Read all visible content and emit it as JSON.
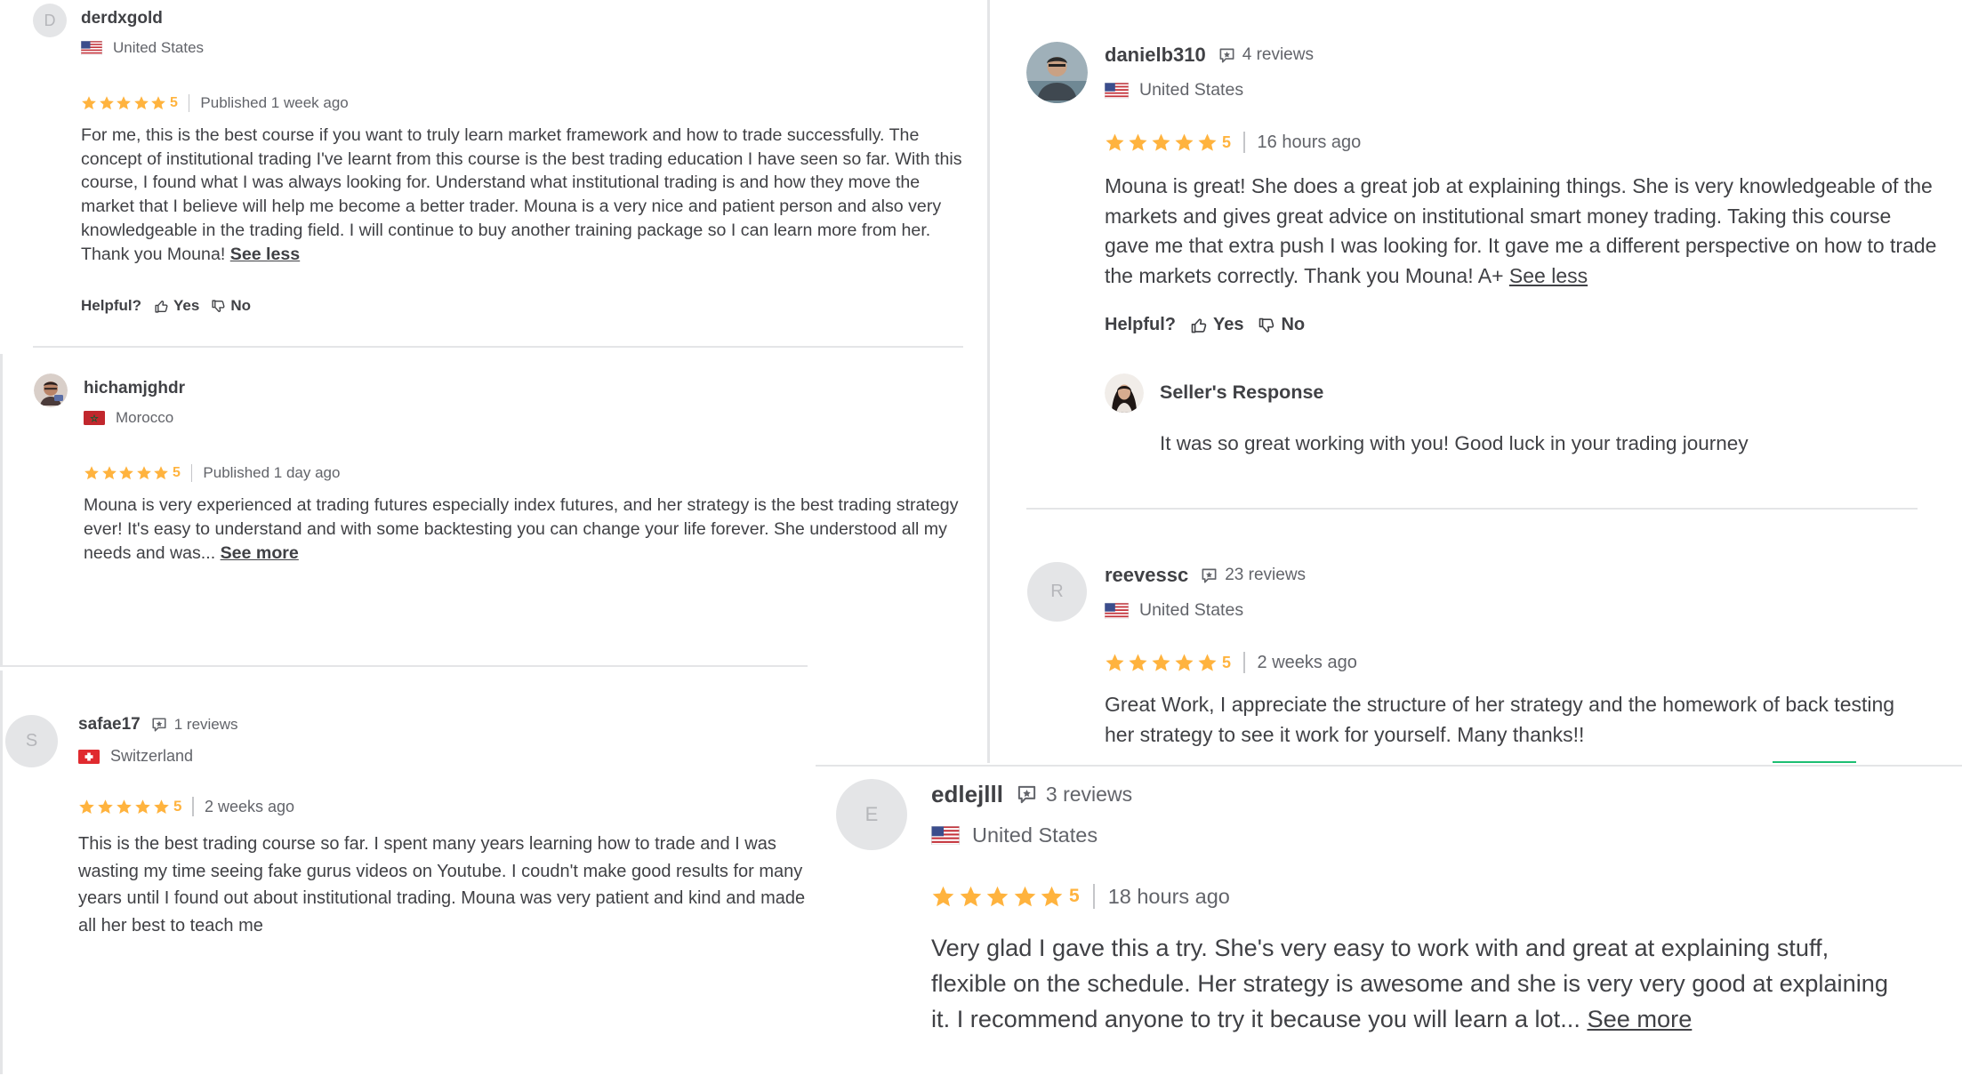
{
  "colors": {
    "star": "#ffb33e",
    "text": "#404145",
    "muted": "#62646a",
    "divider": "#e4e5e7",
    "accent_green": "#1dbf73"
  },
  "reviews": [
    {
      "avatar_letter": "D",
      "username": "derdxgold",
      "country": "United States",
      "rating": "5",
      "date": "Published 1 week ago",
      "text": "For me, this is the best course if you want to truly learn market framework and how to trade successfully. The concept of institutional trading I've learnt from this course is the best trading education I have seen so far. With this course, I found what I was always looking for. Understand what institutional trading is and how they move the market that I believe will help me become a better trader. Mouna is a very nice and patient person and also very knowledgeable in the trading field. I will continue to buy another training package so I can learn more from her. Thank you Mouna!",
      "toggle": "See less",
      "helpful_label": "Helpful?",
      "yes_label": "Yes",
      "no_label": "No"
    },
    {
      "username": "hichamjghdr",
      "country": "Morocco",
      "rating": "5",
      "date": "Published 1 day ago",
      "text": "Mouna is very experienced at trading futures especially index futures, and her strategy is the best trading strategy ever! It's easy to understand and with some backtesting you can change your life forever. She understood all my needs and was...",
      "toggle": "See more"
    },
    {
      "avatar_letter": "S",
      "username": "safae17",
      "reviews_count": "1 reviews",
      "country": "Switzerland",
      "rating": "5",
      "date": "2 weeks ago",
      "text": "This is the best trading course so far. I spent many years learning how to trade and I was wasting my time seeing fake gurus videos on Youtube. I coudn't make good results for many years until I found out about institutional trading. Mouna was very patient and kind and made all her best to teach me"
    },
    {
      "username": "danielb310",
      "reviews_count": "4 reviews",
      "country": "United States",
      "rating": "5",
      "date": "16 hours ago",
      "text": "Mouna is great! She does a great job at explaining things. She is very knowledgeable of the markets and gives great advice on institutional smart money trading. Taking this course gave me that extra push I was looking for. It gave me a different perspective on how to trade the markets correctly. Thank you Mouna! A+",
      "toggle": "See less",
      "helpful_label": "Helpful?",
      "yes_label": "Yes",
      "no_label": "No",
      "seller_response_title": "Seller's Response",
      "seller_response_text": "It was so great working with you! Good luck in your trading journey"
    },
    {
      "avatar_letter": "R",
      "username": "reevessc",
      "reviews_count": "23 reviews",
      "country": "United States",
      "rating": "5",
      "date": "2 weeks ago",
      "text": "Great Work, I appreciate the structure of her strategy and the homework of back testing her strategy to see it work for yourself. Many thanks!!"
    },
    {
      "avatar_letter": "E",
      "username": "edlejlll",
      "reviews_count": "3 reviews",
      "country": "United States",
      "rating": "5",
      "date": "18 hours ago",
      "text": "Very glad I gave this a try. She's very easy to work with and great at explaining stuff, flexible on the schedule. Her strategy is awesome and she is very very good at explaining it. I recommend anyone to try it because you will learn a lot...",
      "toggle": "See more"
    }
  ]
}
